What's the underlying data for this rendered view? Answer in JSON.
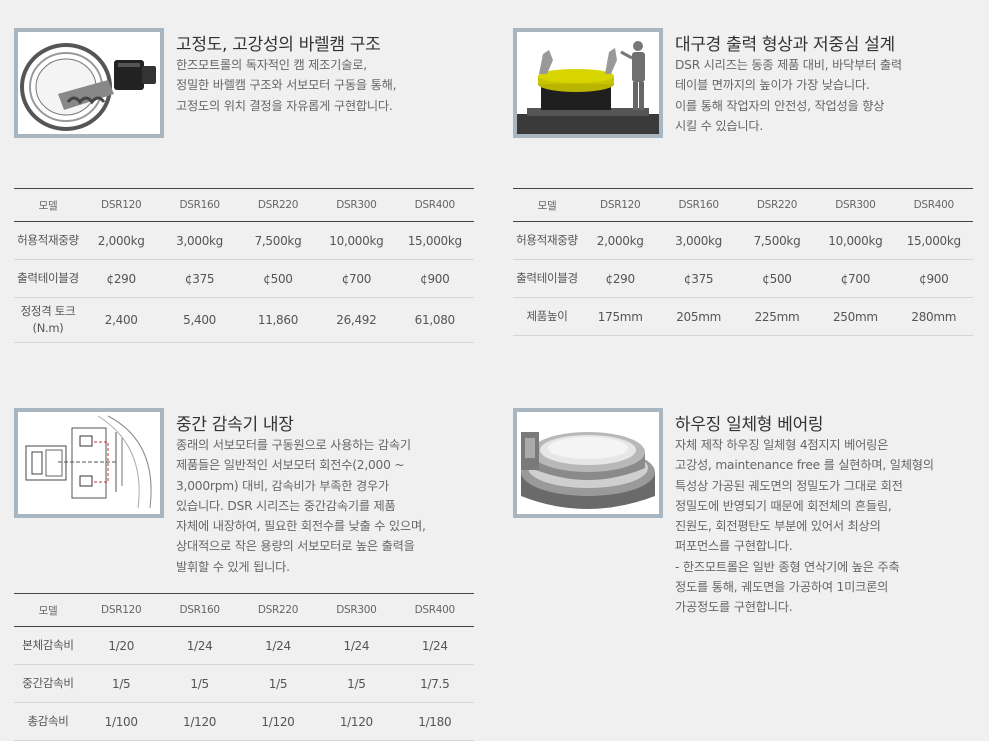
{
  "section1": {
    "image_icon": "slewing-bearing-cam-icon",
    "title": "고정도, 고강성의 바렐캠 구조",
    "desc": [
      "한즈모트롤의 독자적인 캠 제조기술로,",
      "정밀한 바렐캠 구조와 서보모터 구동을 통해,",
      "고정도의 위치 결정을 자유롭게 구현합니다."
    ],
    "table": {
      "headers": [
        "모델",
        "DSR120",
        "DSR160",
        "DSR220",
        "DSR300",
        "DSR400"
      ],
      "rows": [
        [
          "허용적재중량",
          "2,000kg",
          "3,000kg",
          "7,500kg",
          "10,000kg",
          "15,000kg"
        ],
        [
          "출력테이블경",
          "¢290",
          "¢375",
          "¢500",
          "¢700",
          "¢900"
        ],
        [
          "정정격 토크\n(N.m)",
          "2,400",
          "5,400",
          "11,860",
          "26,492",
          "61,080"
        ]
      ]
    }
  },
  "section2": {
    "image_icon": "low-table-operator-icon",
    "title": "대구경 출력 형상과 저중심 설계",
    "desc": [
      "DSR 시리즈는 동종 제품 대비, 바닥부터 출력",
      "테이블 면까지의 높이가 가장 낮습니다.",
      "이를 통해 작업자의 안전성, 작업성을 향상",
      "시킬 수 있습니다."
    ],
    "table": {
      "headers": [
        "모델",
        "DSR120",
        "DSR160",
        "DSR220",
        "DSR300",
        "DSR400"
      ],
      "rows": [
        [
          "허용적재중량",
          "2,000kg",
          "3,000kg",
          "7,500kg",
          "10,000kg",
          "15,000kg"
        ],
        [
          "출력테이블경",
          "¢290",
          "¢375",
          "¢500",
          "¢700",
          "¢900"
        ],
        [
          "제품높이",
          "175mm",
          "205mm",
          "225mm",
          "250mm",
          "280mm"
        ]
      ]
    }
  },
  "section3": {
    "image_icon": "reducer-drawing-icon",
    "title": "중간 감속기 내장",
    "desc": [
      "종래의 서보모터를 구동원으로 사용하는 감속기",
      "제품들은 일반적인 서보모터 회전수(2,000 ~",
      "3,000rpm) 대비, 감속비가 부족한 경우가",
      "있습니다. DSR 시리즈는 중간감속기를 제품",
      "자체에 내장하여, 필요한 회전수를 낮출 수 있으며,",
      "상대적으로 작은 용량의 서보모터로 높은 출력을",
      "발휘할 수 있게 됩니다."
    ],
    "table": {
      "headers": [
        "모델",
        "DSR120",
        "DSR160",
        "DSR220",
        "DSR300",
        "DSR400"
      ],
      "rows": [
        [
          "본체감속비",
          "1/20",
          "1/24",
          "1/24",
          "1/24",
          "1/24"
        ],
        [
          "중간감속비",
          "1/5",
          "1/5",
          "1/5",
          "1/5",
          "1/7.5"
        ],
        [
          "총감속비",
          "1/100",
          "1/120",
          "1/120",
          "1/120",
          "1/180"
        ]
      ]
    }
  },
  "section4": {
    "image_icon": "housing-bearing-icon",
    "title": "하우징 일체형 베어링",
    "desc": [
      "자체 제작 하우징 일체형 4점지지 베어링은",
      "고강성, maintenance free 를 실현하며, 일체형의",
      "특성상 가공된 궤도면의 정밀도가 그대로 회전",
      "정밀도에 반영되기 때문에 회전체의 흔들림,",
      "진원도, 회전평탄도 부분에 있어서 최상의",
      "퍼포먼스를 구현합니다.",
      "- 한즈모트롤은 일반 종형 연삭기에 높은 주축",
      "정도를 통해, 궤도면을 가공하여 1미크론의",
      "가공정도를 구현합니다."
    ]
  }
}
